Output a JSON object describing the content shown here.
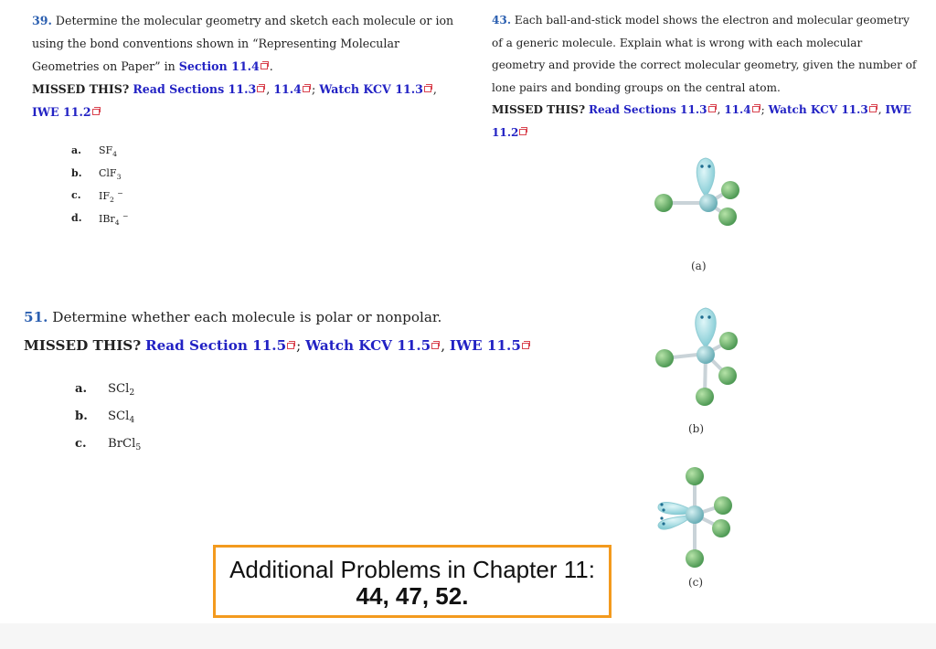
{
  "problem39": {
    "number": "39.",
    "text_line1": " Determine the molecular geometry and sketch each molecule or ion using the bond conventions shown in “Representing Molecular Geometries on Paper” in ",
    "section_link": "Section 11.4",
    "text_end": ".",
    "missed_label": "MISSED THIS?",
    "links": [
      "Read Sections 11.3",
      "11.4",
      "Watch KCV 11.3",
      "IWE 11.2"
    ],
    "items": [
      {
        "label": "a.",
        "formula": "SF",
        "sub": "4",
        "sup": ""
      },
      {
        "label": "b.",
        "formula": "ClF",
        "sub": "3",
        "sup": ""
      },
      {
        "label": "c.",
        "formula": "IF",
        "sub": "2",
        "sup": "−"
      },
      {
        "label": "d.",
        "formula": "IBr",
        "sub": "4",
        "sup": "−"
      }
    ]
  },
  "problem43": {
    "number": "43.",
    "text": " Each ball-and-stick model shows the electron and molecular geometry of a generic molecule. Explain what is wrong with each molecular geometry and provide the correct molecular geometry, given the number of lone pairs and bonding groups on the central atom.",
    "missed_label": "MISSED THIS?",
    "links": [
      "Read Sections 11.3",
      "11.4",
      "Watch KCV 11.3",
      "IWE 11.2"
    ],
    "figures": [
      {
        "label": "(a)",
        "icon": "molecule-model-a"
      },
      {
        "label": "(b)",
        "icon": "molecule-model-b"
      },
      {
        "label": "(c)",
        "icon": "molecule-model-c"
      }
    ]
  },
  "problem51": {
    "number": "51.",
    "text": " Determine whether each molecule is polar or nonpolar.",
    "missed_label": "MISSED THIS?",
    "links": [
      "Read Section 11.5",
      "Watch KCV 11.5",
      "IWE 11.5"
    ],
    "items": [
      {
        "label": "a.",
        "formula": "SCl",
        "sub": "2"
      },
      {
        "label": "b.",
        "formula": "SCl",
        "sub": "4"
      },
      {
        "label": "c.",
        "formula": "BrCl",
        "sub": "5"
      }
    ]
  },
  "additional": {
    "line1": "Additional Problems in Chapter 11:",
    "line2": "44, 47, 52.",
    "border_color": "#f39a1e"
  },
  "colors": {
    "problem_number": "#2b5fb0",
    "link": "#2222c4",
    "external_icon": "#d9434f",
    "atom_outer": "#6fb86a",
    "atom_central": "#8cc9d0",
    "lone_pair": "#9fdbe3"
  }
}
